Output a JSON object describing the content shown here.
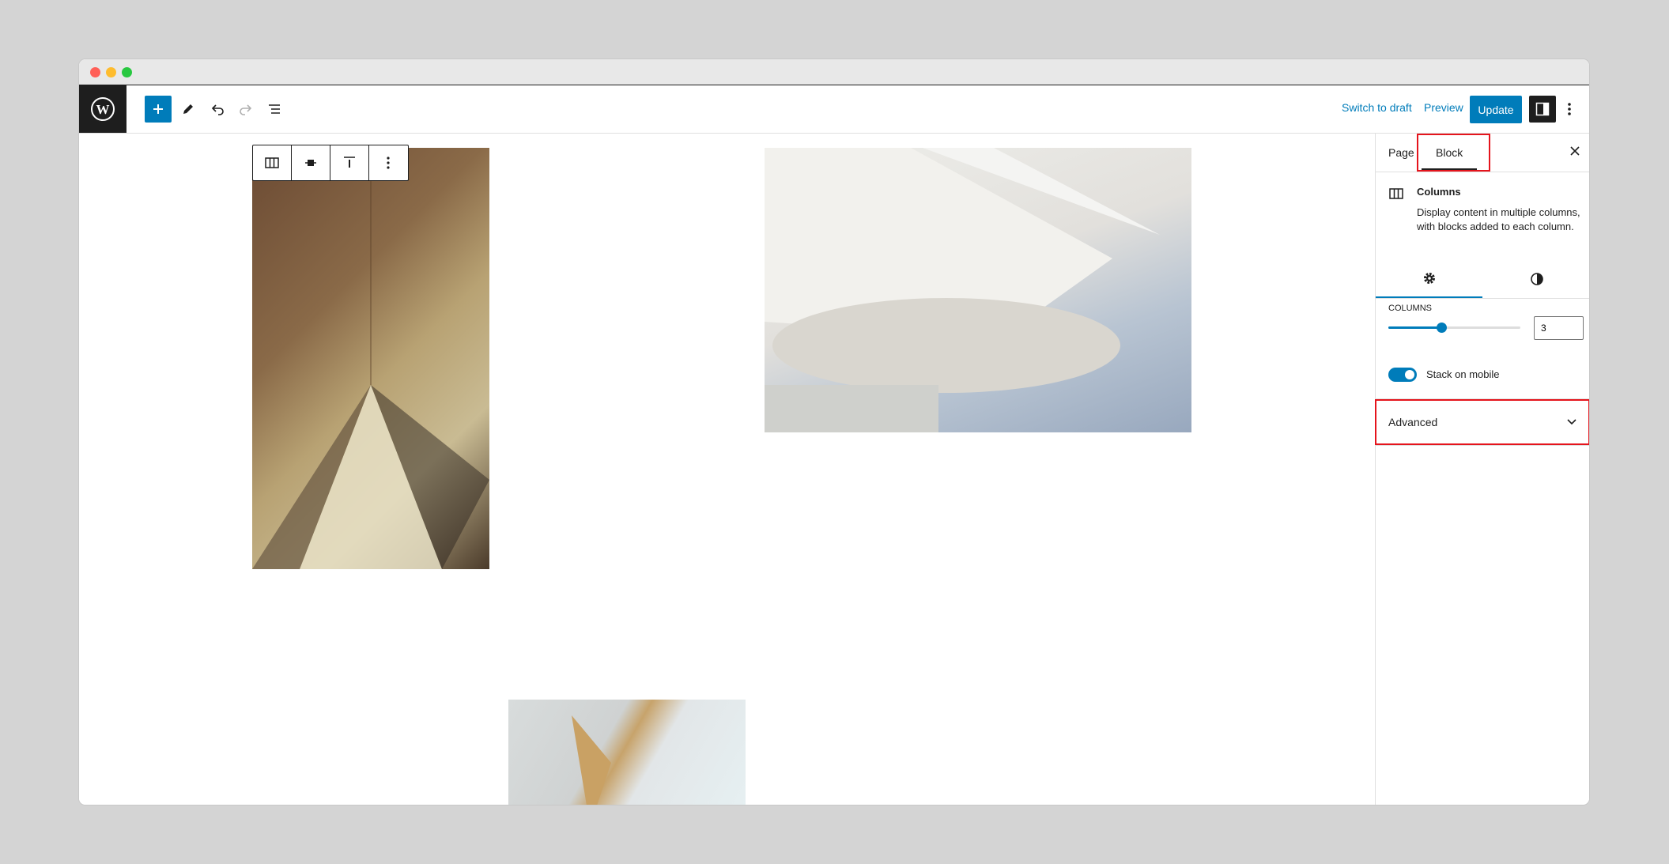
{
  "toolbar": {
    "switch_to_draft": "Switch to draft",
    "preview": "Preview",
    "update": "Update"
  },
  "sidebar": {
    "tabs": [
      {
        "label": "Page"
      },
      {
        "label": "Block"
      }
    ],
    "active_tab": "Block",
    "block_card": {
      "title": "Columns",
      "description": "Display content in multiple columns, with blocks added to each column."
    },
    "columns": {
      "label": "Columns",
      "value": "3",
      "slider_fraction": 0.4
    },
    "stack_on_mobile": {
      "label": "Stack on mobile",
      "enabled": true
    },
    "advanced": {
      "label": "Advanced"
    }
  },
  "colors": {
    "accent": "#007cba",
    "dark": "#1e1e1e",
    "highlight": "#e5141c"
  }
}
